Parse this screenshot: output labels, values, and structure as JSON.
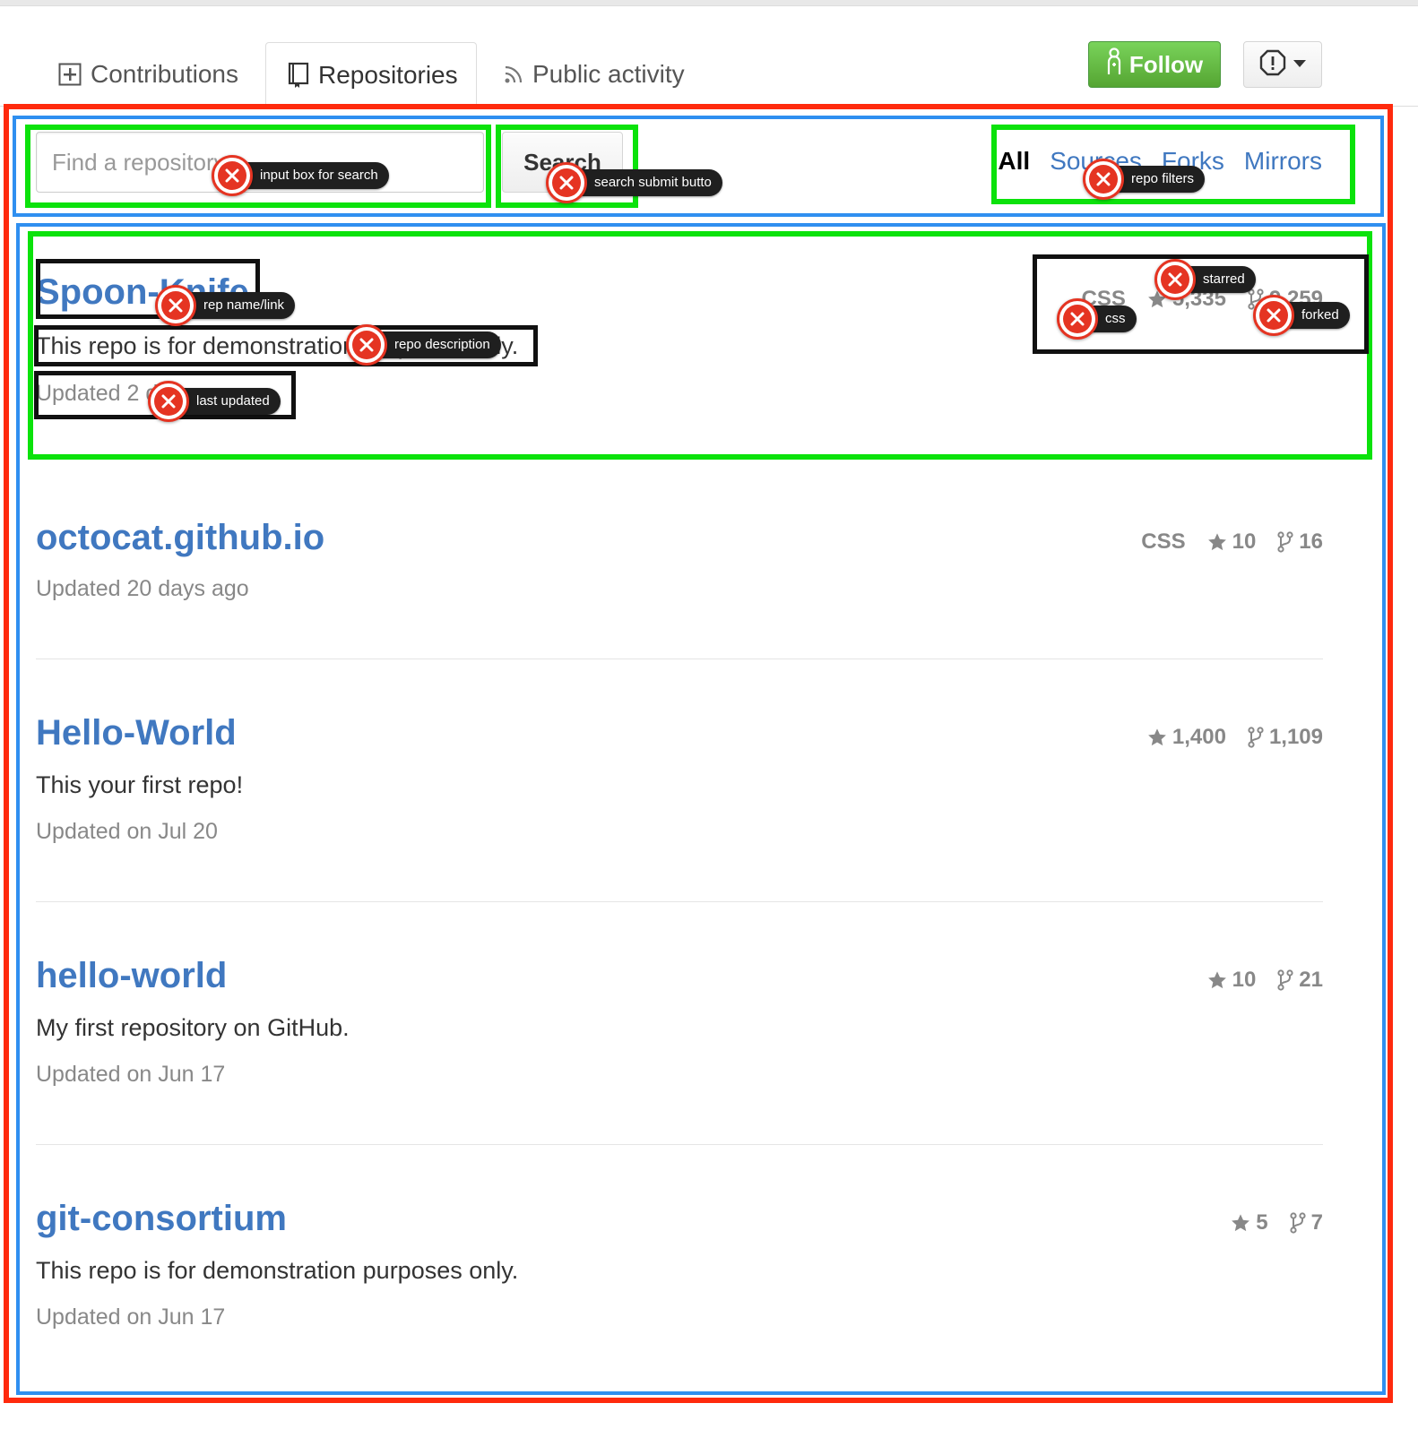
{
  "tabs": [
    {
      "label": "Contributions",
      "icon": "plus-box-icon"
    },
    {
      "label": "Repositories",
      "icon": "repo-book-icon",
      "active": true
    },
    {
      "label": "Public activity",
      "icon": "rss-icon"
    }
  ],
  "follow_label": "Follow",
  "search": {
    "placeholder": "Find a repository…",
    "button_label": "Search"
  },
  "filters": [
    "All",
    "Sources",
    "Forks",
    "Mirrors"
  ],
  "repos": [
    {
      "name": "Spoon-Knife",
      "description": "This repo is for demonstration purposes only.",
      "updated": "Updated 2 days ago",
      "language": "CSS",
      "stars": "5,335",
      "forks": "9,259"
    },
    {
      "name": "octocat.github.io",
      "description": "",
      "updated": "Updated 20 days ago",
      "language": "CSS",
      "stars": "10",
      "forks": "16"
    },
    {
      "name": "Hello-World",
      "description": "This your first repo!",
      "updated": "Updated on Jul 20",
      "language": "",
      "stars": "1,400",
      "forks": "1,109"
    },
    {
      "name": "hello-world",
      "description": "My first repository on GitHub.",
      "updated": "Updated on Jun 17",
      "language": "",
      "stars": "10",
      "forks": "21"
    },
    {
      "name": "git-consortium",
      "description": "This repo is for demonstration purposes only.",
      "updated": "Updated on Jun 17",
      "language": "",
      "stars": "5",
      "forks": "7"
    }
  ],
  "annotations": {
    "search_input": "input box for search",
    "search_button": "search submit butto",
    "filters": "repo filters",
    "repo_name": "rep name/link",
    "repo_description": "repo description",
    "last_updated": "last updated",
    "starred": "starred",
    "css": "css",
    "forked": "forked"
  },
  "colors": {
    "link": "#4078c0",
    "follow_green": "#55a532",
    "marker_red": "#e53422",
    "box_red": "#ff2a0d",
    "box_blue": "#2f8ff0",
    "box_green": "#0be20b"
  }
}
